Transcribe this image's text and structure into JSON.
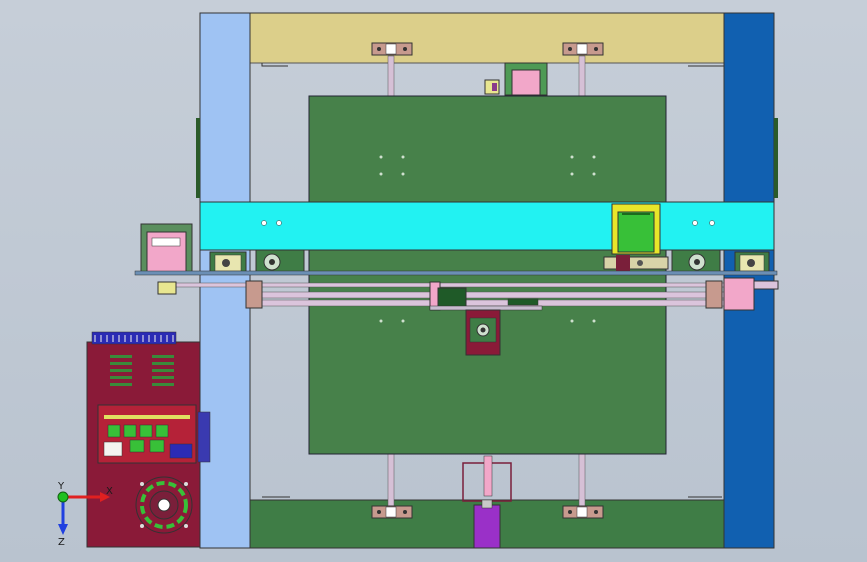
{
  "viewport": {
    "background": "#bfc9d3"
  },
  "triad": {
    "x_label": "X",
    "y_label": "Y",
    "z_label": "Z",
    "x_color": "#e02020",
    "y_color": "#20c020",
    "z_color": "#2040e0"
  },
  "colors": {
    "left_rail": "#9fc3f3",
    "right_rail": "#1160b0",
    "top_plate": "#dccf8a",
    "bottom_plate": "#3f7d46",
    "bed": "#47814a",
    "gantry_beam": "#22f2f2",
    "controller_box": "#8a1a38",
    "x_motor": "#f2a7c9",
    "y_motor": "#38c038",
    "z_motor": "#9a30c8"
  }
}
